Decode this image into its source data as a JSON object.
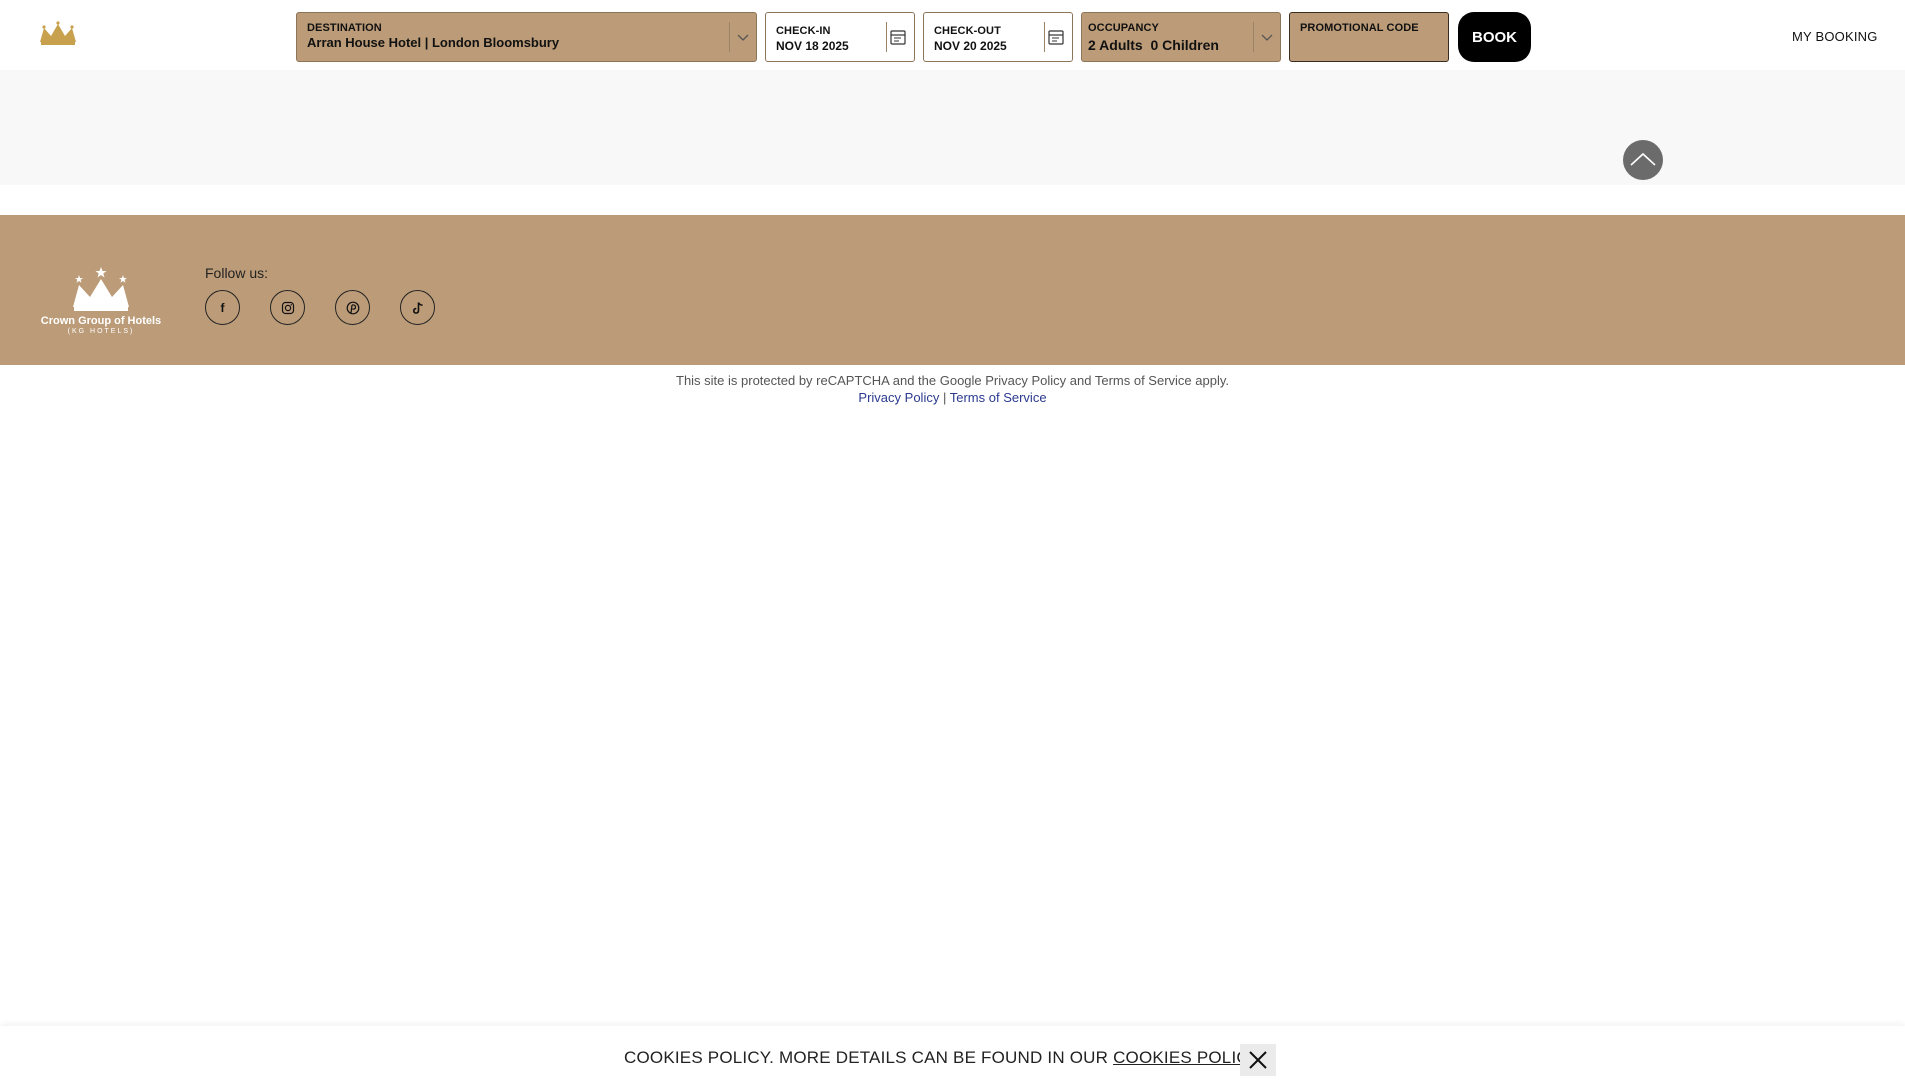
{
  "header": {
    "destination": {
      "label": "DESTINATION",
      "value": "Arran House Hotel | London Bloomsbury"
    },
    "check_in": {
      "label": "CHECK-IN",
      "value": "NOV 18 2025"
    },
    "check_out": {
      "label": "CHECK-OUT",
      "value": "NOV 20 2025"
    },
    "occupancy": {
      "label": "OCCUPANCY",
      "value": "2 Adults  0 Children"
    },
    "promo": {
      "label": "PROMOTIONAL CODE",
      "value": ""
    },
    "book_label": "BOOK",
    "my_booking": "MY BOOKING"
  },
  "footer": {
    "brand": "Crown Group of Hotels",
    "brand_sub": "(KG HOTELS)",
    "follow_label": "Follow us:",
    "social": [
      {
        "name": "facebook",
        "glyph": "f"
      },
      {
        "name": "instagram",
        "glyph": "◎"
      },
      {
        "name": "pinterest",
        "glyph": "℗"
      },
      {
        "name": "tiktok",
        "glyph": "♪"
      }
    ]
  },
  "legal": {
    "recaptcha_text": "This site is protected by reCAPTCHA and the Google Privacy Policy and Terms of Service apply.",
    "privacy_link": "Privacy Policy",
    "separator": "|",
    "terms_link": "Terms of Service"
  },
  "cookie": {
    "text": "COOKIES POLICY. MORE DETAILS CAN BE FOUND IN OUR",
    "link": "COOKIES POLICY"
  },
  "colors": {
    "brand_tan": "#bc9c78",
    "brand_gold": "#c8a14e",
    "link_blue": "#2b3a8f",
    "book_black": "#000000"
  }
}
